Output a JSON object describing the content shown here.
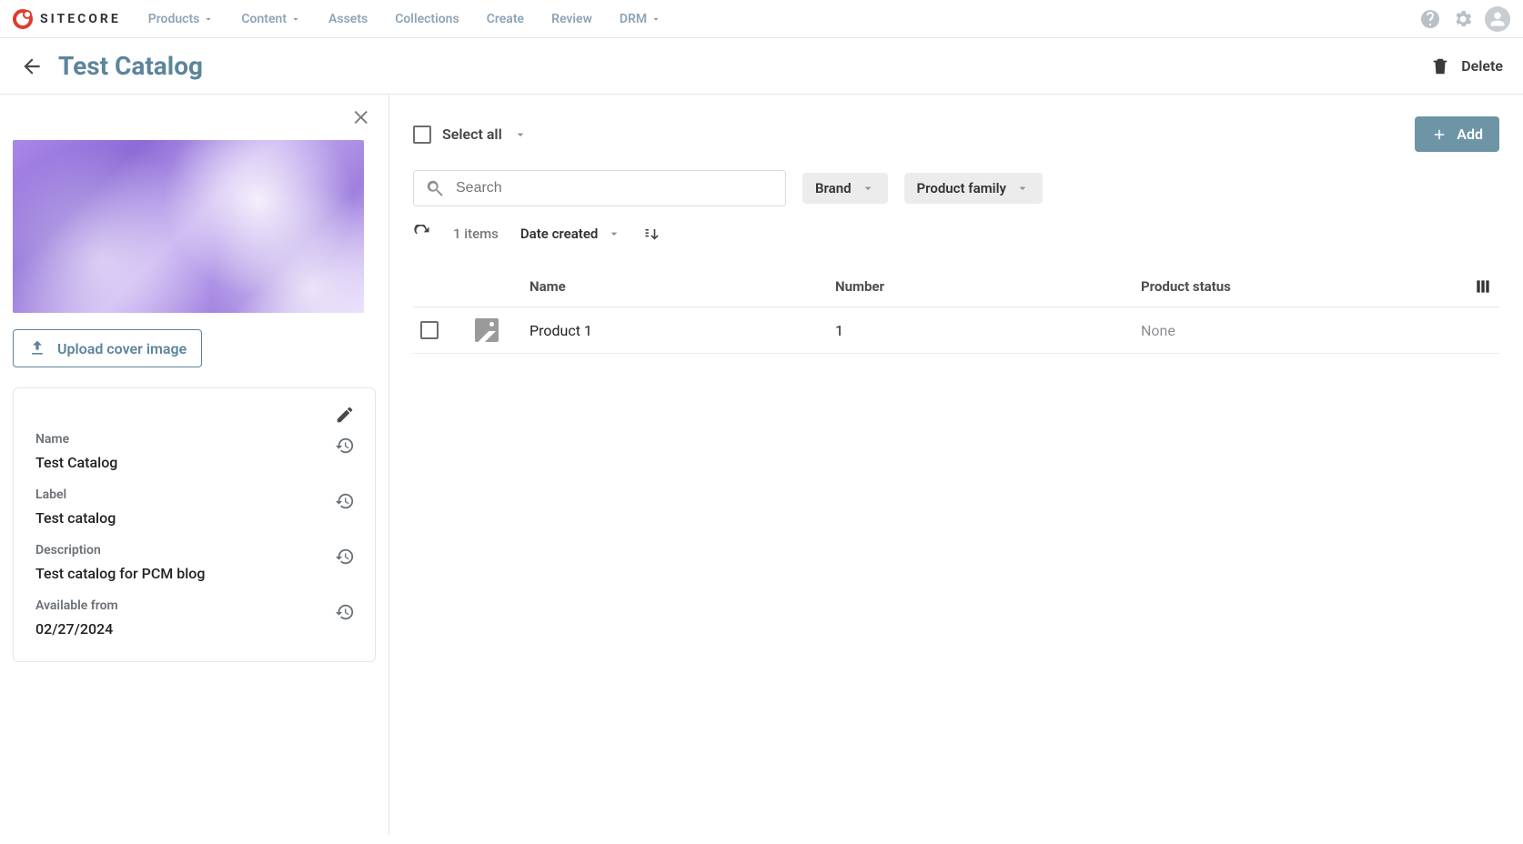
{
  "brand": "SITECORE",
  "nav": {
    "products": "Products",
    "content": "Content",
    "assets": "Assets",
    "collections": "Collections",
    "create": "Create",
    "review": "Review",
    "drm": "DRM"
  },
  "header": {
    "title": "Test Catalog",
    "delete": "Delete"
  },
  "sidebar": {
    "upload_label": "Upload cover image",
    "fields": {
      "name_label": "Name",
      "name_value": "Test Catalog",
      "label_label": "Label",
      "label_value": "Test catalog",
      "description_label": "Description",
      "description_value": "Test catalog for PCM blog",
      "available_label": "Available from",
      "available_value": "02/27/2024"
    }
  },
  "main": {
    "select_all": "Select all",
    "add": "Add",
    "search_placeholder": "Search",
    "filter_brand": "Brand",
    "filter_family": "Product family",
    "items_count": "1 items",
    "sort_label": "Date created",
    "columns": {
      "name": "Name",
      "number": "Number",
      "status": "Product status"
    },
    "rows": [
      {
        "name": "Product 1",
        "number": "1",
        "status": "None"
      }
    ]
  }
}
